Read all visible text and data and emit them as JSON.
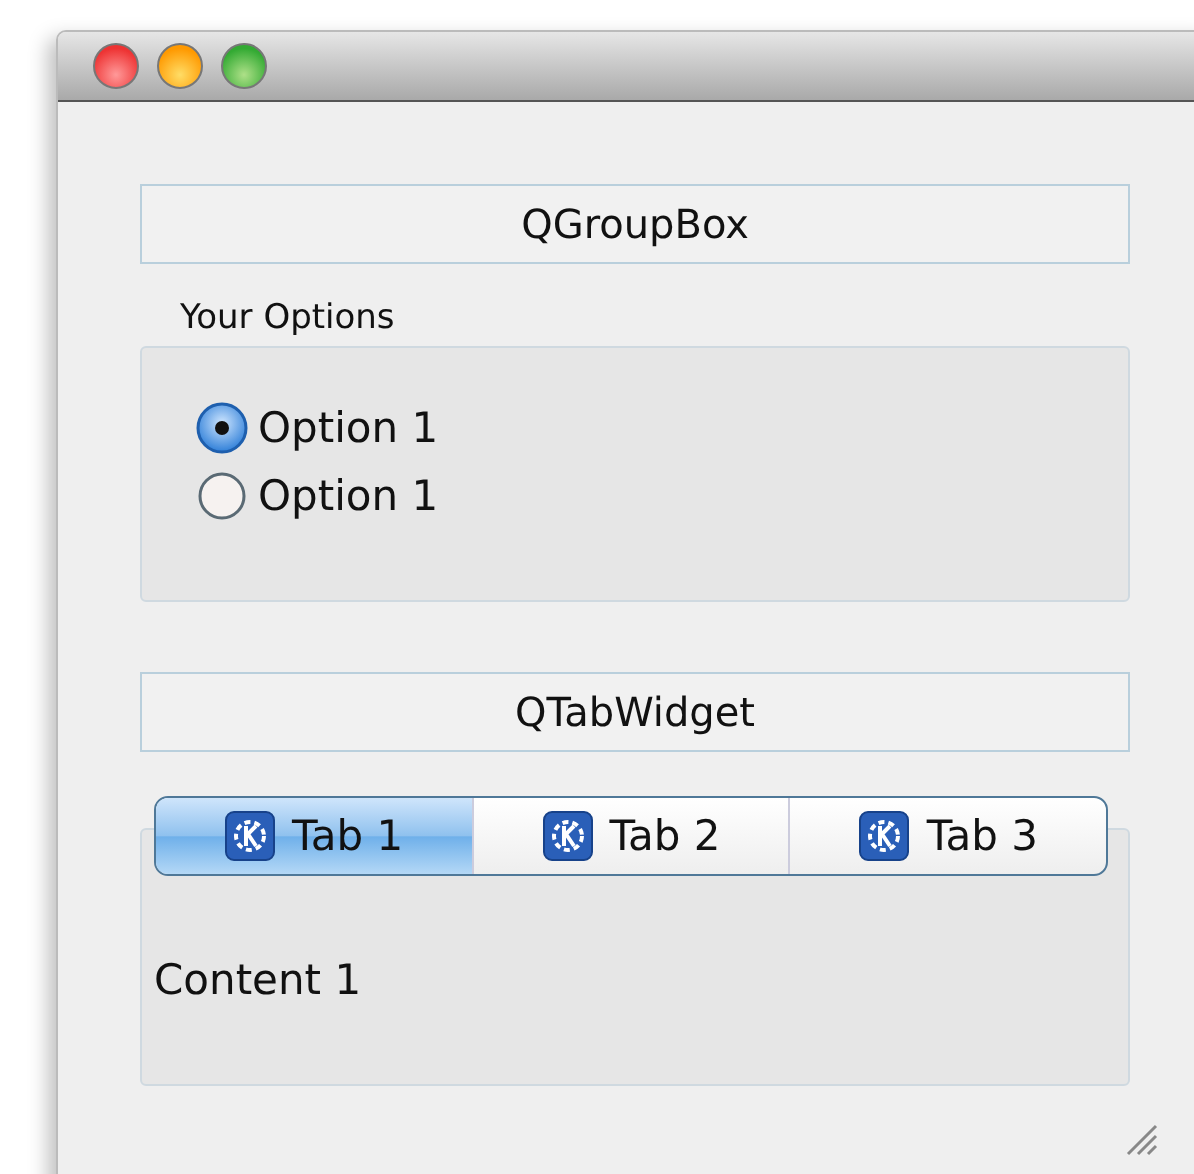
{
  "group_box_title": "QGroupBox",
  "group": {
    "title": "Your Options",
    "options": [
      {
        "label": "Option 1",
        "selected": true
      },
      {
        "label": "Option 1",
        "selected": false
      }
    ]
  },
  "tab_widget_title": "QTabWidget",
  "tabs": [
    {
      "label": "Tab 1",
      "selected": true
    },
    {
      "label": "Tab 2",
      "selected": false
    },
    {
      "label": "Tab 3",
      "selected": false
    }
  ],
  "tab_content": "Content 1"
}
